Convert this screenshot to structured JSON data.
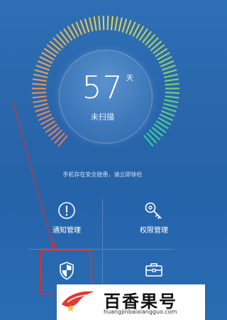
{
  "security": {
    "days_value": "57",
    "days_unit": "天",
    "status": "未扫描",
    "hint": "手机存在安全隐患，请立即体检"
  },
  "tiles": [
    {
      "label": "通知管理",
      "icon": "notification-exclamation-icon"
    },
    {
      "label": "权限管理",
      "icon": "key-icon"
    },
    {
      "label": "",
      "icon": "shield-icon"
    },
    {
      "label": "",
      "icon": "briefcase-icon"
    }
  ],
  "gauge_colors": {
    "start": "#e9785a",
    "mid": "#f0d04a",
    "end": "#36d49a"
  },
  "watermark": {
    "title": "百香果号",
    "url": "huangjinbaixiangguo.com",
    "logo_color": "#e23a2f"
  }
}
